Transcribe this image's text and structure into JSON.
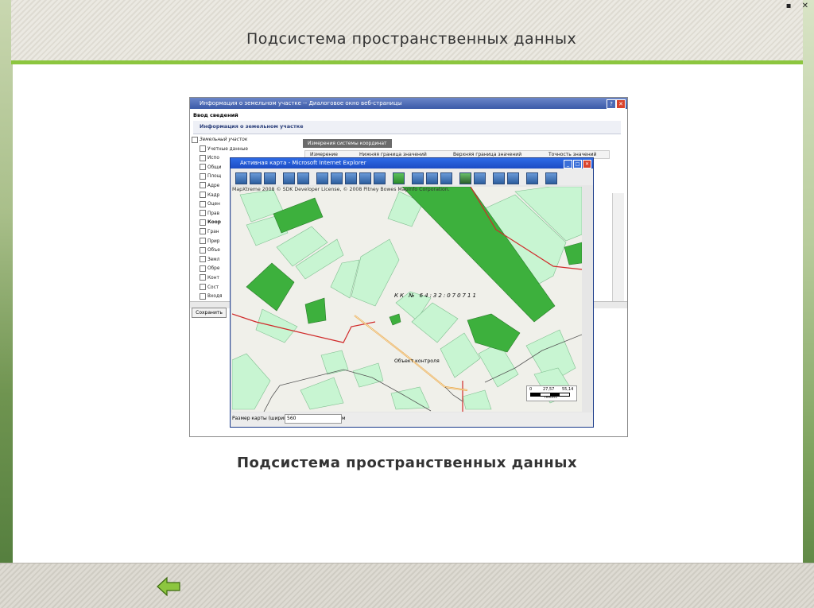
{
  "slide": {
    "title": "Подсистема пространственных данных",
    "caption": "Подсистема пространственных данных",
    "window_controls": "▪ ✕"
  },
  "dialog": {
    "title": "Информация о земельном участке -- Диалоговое окно веб-страницы",
    "input_label": "Ввод сведений",
    "panel_title": "Информация о земельном участке",
    "save_label": "Сохранить",
    "tree": [
      {
        "label": "Земельный участок"
      },
      {
        "label": "Учетные данные"
      },
      {
        "label": "Испо"
      },
      {
        "label": "Общи"
      },
      {
        "label": "Площ"
      },
      {
        "label": "Адре"
      },
      {
        "label": "Кадр"
      },
      {
        "label": "Оцен"
      },
      {
        "label": "Прав"
      },
      {
        "label": "Коор"
      },
      {
        "label": "Гран"
      },
      {
        "label": "Прир"
      },
      {
        "label": "Объе"
      },
      {
        "label": "Земл"
      },
      {
        "label": "Обре"
      },
      {
        "label": "Конт"
      },
      {
        "label": "Сост"
      },
      {
        "label": "Входя"
      }
    ],
    "tab_label": "Измерения системы координат",
    "columns": [
      "Измерение",
      "Нижняя граница значений",
      "Верхняя граница значений",
      "Точность значений"
    ]
  },
  "map_window": {
    "title": "Активная карта - Microsoft Internet Explorer",
    "copyright": "MapXtreme 2008 © SDK Developer License, © 2008 Pitney Bowes MapInfo Corporation.",
    "cadastral_number": "КК № 64:32:070711",
    "object_label": "Объект контроля",
    "scale_labels": [
      "0",
      "27,57",
      "55,14"
    ],
    "scale_unit": "meters",
    "size_label": "Размер карты (ширина)",
    "size_value": "560",
    "size_unit": "м"
  },
  "colors": {
    "accent_green": "#8cc63f",
    "parcel_dark": "#3db03d",
    "parcel_light": "#c8f5d2",
    "road_red": "#d02a2a",
    "road_orange": "#e8a23a"
  },
  "icons": {
    "back": "back-arrow-icon"
  }
}
